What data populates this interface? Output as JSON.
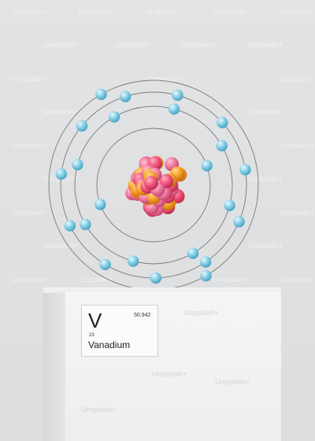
{
  "element": {
    "symbol": "V",
    "atomic_mass": "50.942",
    "atomic_number": "23",
    "name": "Vanadium"
  },
  "atom": {
    "electron_shells": [
      2,
      8,
      11,
      2
    ],
    "electron_color": "#8fd3e8",
    "nucleus_colors": [
      "#f2557a",
      "#f6a12a",
      "#f07aa0"
    ],
    "orbit_color": "#7a7a7a"
  },
  "watermark": "Unsplash+",
  "colors": {
    "background": "#e0e1e3",
    "pedestal": "#f2f2f3"
  }
}
